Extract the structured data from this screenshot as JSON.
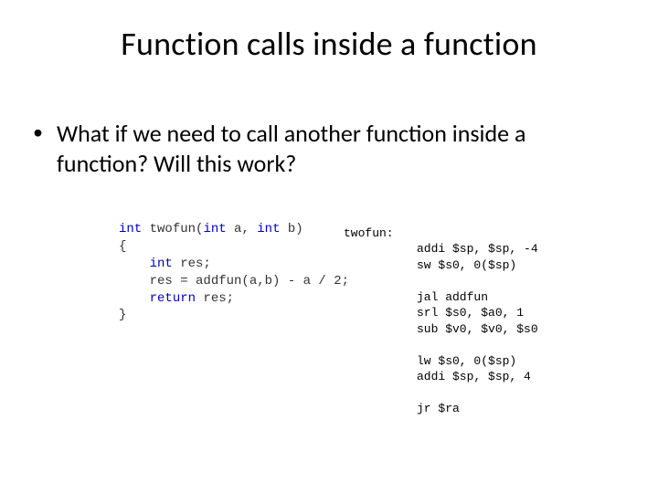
{
  "title": "Function calls inside a function",
  "bullet": {
    "dot": "•",
    "text": "What if we need to call another function inside a function? Will this work?"
  },
  "c_code": {
    "l1a": "int",
    "l1b": " twofun(",
    "l1c": "int",
    "l1d": " a, ",
    "l1e": "int",
    "l1f": " b)",
    "l2": "{",
    "l3a": "    ",
    "l3b": "int",
    "l3c": " res;",
    "l4": "    res = addfun(a,b) - a / 2;",
    "l5a": "    ",
    "l5b": "return",
    "l5c": " res;",
    "l6": "}"
  },
  "asm_label": "twofun:",
  "asm": {
    "l1": "addi $sp, $sp, -4",
    "l2": "sw $s0, 0($sp)",
    "b1": "",
    "l3": "jal addfun",
    "l4": "srl $s0, $a0, 1",
    "l5": "sub $v0, $v0, $s0",
    "b2": "",
    "l6": "lw $s0, 0($sp)",
    "l7": "addi $sp, $sp, 4",
    "b3": "",
    "l8": "jr $ra"
  }
}
